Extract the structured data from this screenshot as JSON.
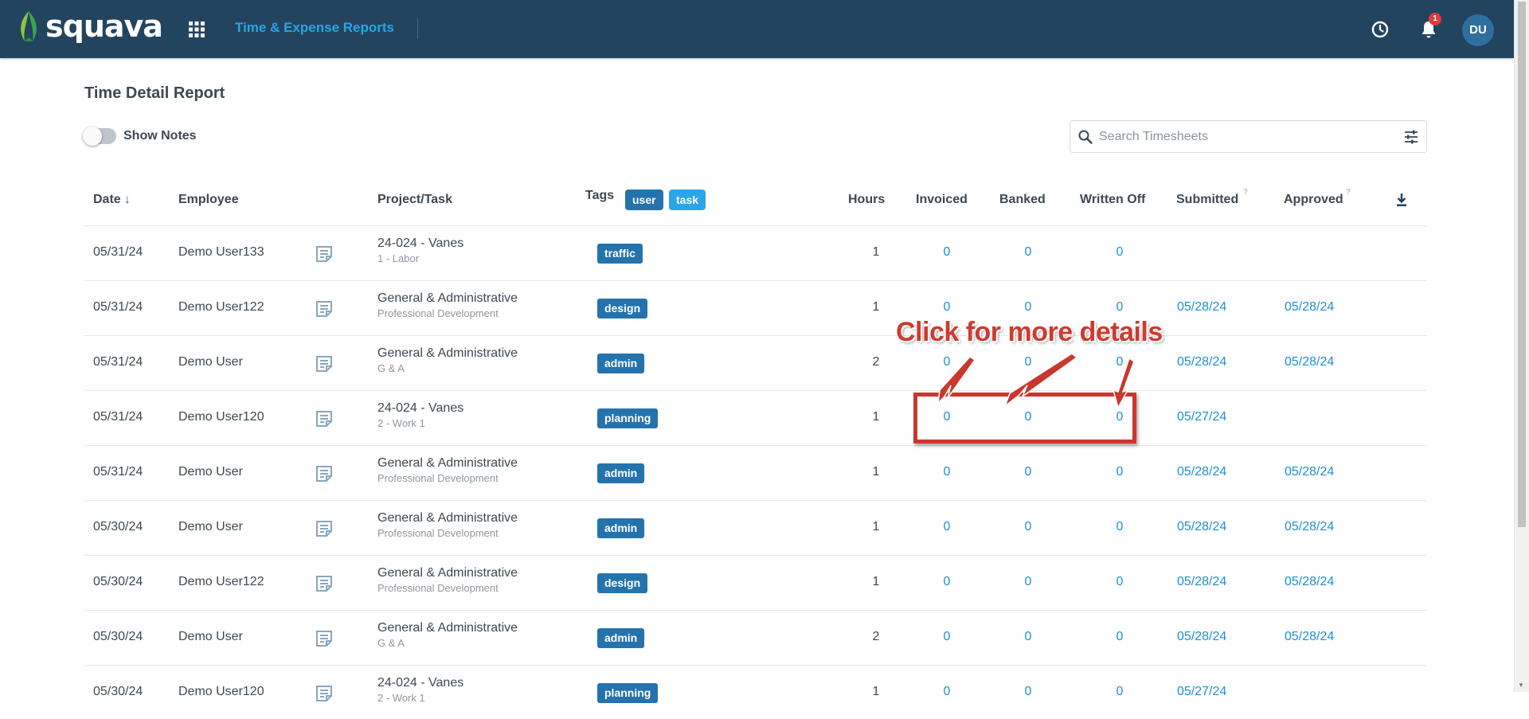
{
  "header": {
    "logo_text": "squava",
    "app_title": "Time & Expense Reports",
    "notification_count": "1",
    "avatar_initials": "DU",
    "icons": [
      "apps-grid-icon",
      "clock-icon",
      "bell-icon"
    ],
    "background_color": "#22445f",
    "accent_color": "#2aa5e8"
  },
  "page": {
    "title": "Time Detail Report",
    "show_notes_label": "Show Notes",
    "show_notes_on": false,
    "search_placeholder": "Search Timesheets"
  },
  "table": {
    "columns": {
      "date": "Date",
      "employee": "Employee",
      "project_task": "Project/Task",
      "tags": "Tags",
      "hours": "Hours",
      "invoiced": "Invoiced",
      "banked": "Banked",
      "written_off": "Written Off",
      "submitted": "Submitted",
      "approved": "Approved",
      "help_mark": "?"
    },
    "tag_filters": [
      {
        "label": "user",
        "color": "#2473ad"
      },
      {
        "label": "task",
        "color": "#2aa5e8"
      }
    ],
    "rows": [
      {
        "date": "05/31/24",
        "employee": "Demo User133",
        "project": "24-024 - Vanes",
        "task": "1 - Labor",
        "tag": "traffic",
        "hours": "1",
        "invoiced": "0",
        "banked": "0",
        "written_off": "0",
        "submitted": "",
        "approved": ""
      },
      {
        "date": "05/31/24",
        "employee": "Demo User122",
        "project": "General & Administrative",
        "task": "Professional Development",
        "tag": "design",
        "hours": "1",
        "invoiced": "0",
        "banked": "0",
        "written_off": "0",
        "submitted": "05/28/24",
        "approved": "05/28/24"
      },
      {
        "date": "05/31/24",
        "employee": "Demo User",
        "project": "General & Administrative",
        "task": "G & A",
        "tag": "admin",
        "hours": "2",
        "invoiced": "0",
        "banked": "0",
        "written_off": "0",
        "submitted": "05/28/24",
        "approved": "05/28/24"
      },
      {
        "date": "05/31/24",
        "employee": "Demo User120",
        "project": "24-024 - Vanes",
        "task": "2 - Work 1",
        "tag": "planning",
        "hours": "1",
        "invoiced": "0",
        "banked": "0",
        "written_off": "0",
        "submitted": "05/27/24",
        "approved": ""
      },
      {
        "date": "05/31/24",
        "employee": "Demo User",
        "project": "General & Administrative",
        "task": "Professional Development",
        "tag": "admin",
        "hours": "1",
        "invoiced": "0",
        "banked": "0",
        "written_off": "0",
        "submitted": "05/28/24",
        "approved": "05/28/24"
      },
      {
        "date": "05/30/24",
        "employee": "Demo User",
        "project": "General & Administrative",
        "task": "Professional Development",
        "tag": "admin",
        "hours": "1",
        "invoiced": "0",
        "banked": "0",
        "written_off": "0",
        "submitted": "05/28/24",
        "approved": "05/28/24"
      },
      {
        "date": "05/30/24",
        "employee": "Demo User122",
        "project": "General & Administrative",
        "task": "Professional Development",
        "tag": "design",
        "hours": "1",
        "invoiced": "0",
        "banked": "0",
        "written_off": "0",
        "submitted": "05/28/24",
        "approved": "05/28/24"
      },
      {
        "date": "05/30/24",
        "employee": "Demo User",
        "project": "General & Administrative",
        "task": "G & A",
        "tag": "admin",
        "hours": "2",
        "invoiced": "0",
        "banked": "0",
        "written_off": "0",
        "submitted": "05/28/24",
        "approved": "05/28/24"
      },
      {
        "date": "05/30/24",
        "employee": "Demo User120",
        "project": "24-024 - Vanes",
        "task": "2 - Work 1",
        "tag": "planning",
        "hours": "1",
        "invoiced": "0",
        "banked": "0",
        "written_off": "0",
        "submitted": "05/27/24",
        "approved": ""
      }
    ]
  },
  "annotation": {
    "text": "Click for more details",
    "color": "#cf3a2f"
  }
}
